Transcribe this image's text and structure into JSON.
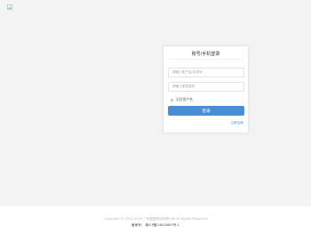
{
  "logo": {
    "icon": "broken-image-icon"
  },
  "login": {
    "title": "账号/手机登录",
    "username_placeholder": "请输入账户名/手机号",
    "password_placeholder": "请输入登录密码",
    "remember_label": "记住用户名",
    "submit_label": "登录",
    "register_link": "立即注册"
  },
  "footer": {
    "copyright": "Copyright © 2013-2019 广州数据科技有限公司 All Rights Reserved",
    "icp": "备案号：  粤ICP备14002667号-1"
  },
  "colors": {
    "page_background": "#f3f3f3",
    "primary_button": "#4a8fd6",
    "link": "#3f86d1"
  }
}
